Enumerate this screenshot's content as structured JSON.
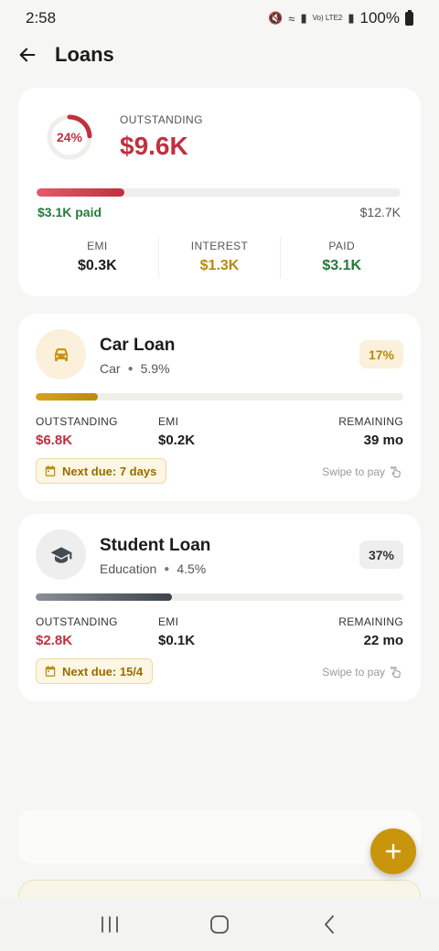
{
  "status_bar": {
    "time": "2:58",
    "network": "Vo) LTE2",
    "battery": "100%"
  },
  "header": {
    "title": "Loans"
  },
  "summary": {
    "ring_percent": "24%",
    "ring_fraction": 0.24,
    "outstanding_label": "OUTSTANDING",
    "outstanding_value": "$9.6K",
    "progress_fraction": 0.24,
    "paid_text": "$3.1K paid",
    "total_text": "$12.7K",
    "stats": [
      {
        "label": "EMI",
        "value": "$0.3K",
        "color": "#1b1b1b"
      },
      {
        "label": "INTEREST",
        "value": "$1.3K",
        "color": "#b68a0e"
      },
      {
        "label": "PAID",
        "value": "$3.1K",
        "color": "#237a3b"
      }
    ]
  },
  "loans": [
    {
      "name": "Car Loan",
      "category": "Car",
      "rate": "5.9%",
      "percent": "17%",
      "progress_fraction": 0.17,
      "icon": "car-icon",
      "colors": {
        "icon_bg": "#faf0dc",
        "icon": "#c8950c",
        "badge_bg": "#fbf0d9",
        "badge_text": "#b68a0e",
        "bar_start": "#d7a21e",
        "bar_end": "#b88914"
      },
      "outstanding_label": "OUTSTANDING",
      "outstanding_value": "$6.8K",
      "emi_label": "EMI",
      "emi_value": "$0.2K",
      "remaining_label": "REMAINING",
      "remaining_value": "39 mo",
      "next_due": "Next due: 7 days",
      "swipe_hint": "Swipe to pay"
    },
    {
      "name": "Student Loan",
      "category": "Education",
      "rate": "4.5%",
      "percent": "37%",
      "progress_fraction": 0.37,
      "icon": "graduation-cap-icon",
      "colors": {
        "icon_bg": "#eeeeee",
        "icon": "#444b52",
        "badge_bg": "#eeeeee",
        "badge_text": "#333",
        "bar_start": "#8a9097",
        "bar_end": "#3d434a"
      },
      "outstanding_label": "OUTSTANDING",
      "outstanding_value": "$2.8K",
      "emi_label": "EMI",
      "emi_value": "$0.1K",
      "remaining_label": "REMAINING",
      "remaining_value": "22 mo",
      "next_due": "Next due: 15/4",
      "swipe_hint": "Swipe to pay"
    }
  ],
  "colors": {
    "accent": "#c8950c",
    "danger": "#c0303f",
    "success": "#237a3b"
  }
}
